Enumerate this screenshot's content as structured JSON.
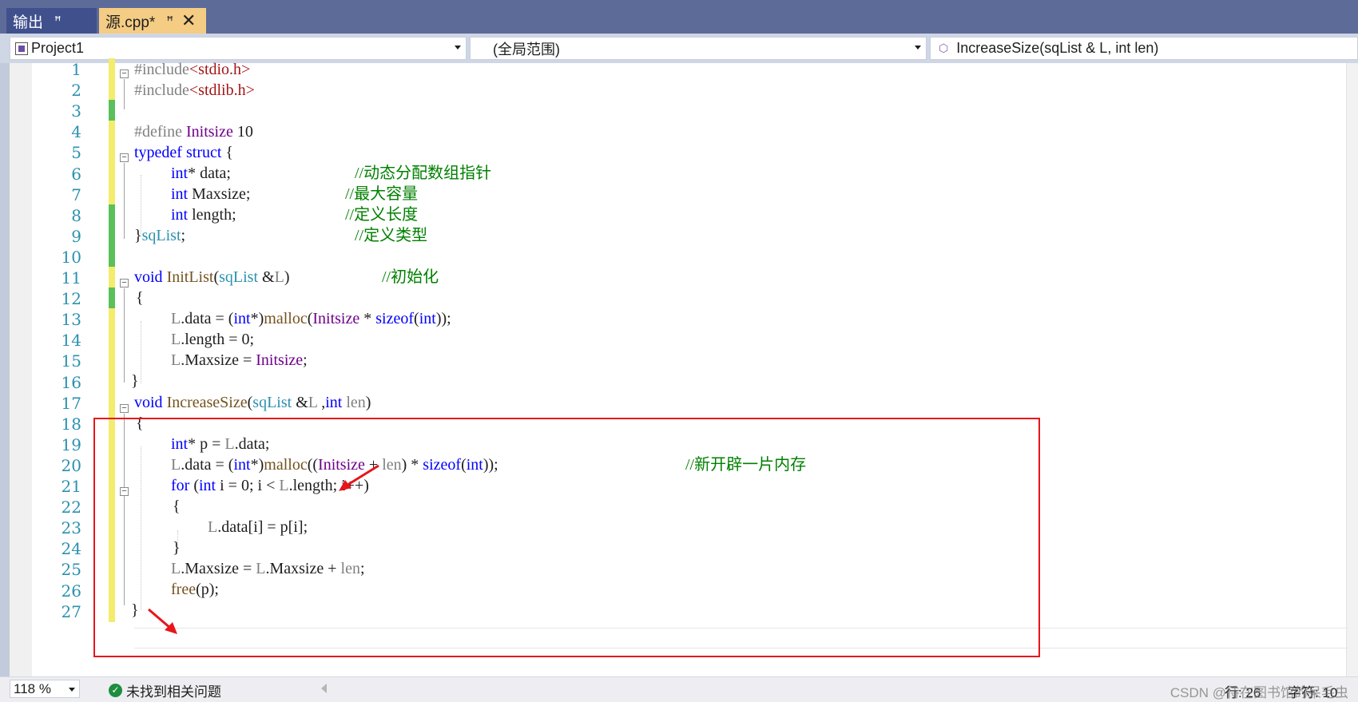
{
  "tabs": [
    {
      "label": "输出",
      "pin": "ꟸ"
    },
    {
      "label": "源.cpp*",
      "pin": "ꟸ",
      "close": "✕"
    }
  ],
  "nav": {
    "project": "Project1",
    "scope": "(全局范围)",
    "member": "IncreaseSize(sqList & L, int len)"
  },
  "line_numbers": [
    "1",
    "2",
    "3",
    "4",
    "5",
    "6",
    "7",
    "8",
    "9",
    "10",
    "11",
    "12",
    "13",
    "14",
    "15",
    "16",
    "17",
    "18",
    "19",
    "20",
    "21",
    "22",
    "23",
    "24",
    "25",
    "26",
    "27"
  ],
  "code": {
    "l1": {
      "a": "#include",
      "b": "<stdio.h>"
    },
    "l2": {
      "a": "#include",
      "b": "<stdlib.h>"
    },
    "l4": {
      "a": "#define ",
      "b": "Initsize",
      "c": " 10"
    },
    "l5": {
      "a": "typedef",
      "b": " ",
      "c": "struct",
      "d": " {"
    },
    "l6": {
      "a": "int",
      "b": "* data;",
      "c": "//动态分配数组指针"
    },
    "l7": {
      "a": "int",
      "b": " Maxsize;",
      "c": "//最大容量"
    },
    "l8": {
      "a": "int",
      "b": " length;",
      "c": "//定义长度"
    },
    "l9": {
      "a": "}",
      "b": "sqList",
      "c": ";",
      "d": "//定义类型"
    },
    "l11": {
      "a": "void",
      "b": " ",
      "c": "InitList",
      "d": "(",
      "e": "sqList",
      "f": " &",
      "g": "L",
      "h": ")",
      "i": "//初始化"
    },
    "l12": {
      "a": "{"
    },
    "l13": {
      "a": "L",
      "b": ".data = (",
      "c": "int",
      "d": "*)",
      "e": "malloc",
      "f": "(",
      "g": "Initsize",
      "h": " * ",
      "i": "sizeof",
      "j": "(",
      "k": "int",
      "l": "));"
    },
    "l14": {
      "a": "L",
      "b": ".length = 0;"
    },
    "l15": {
      "a": "L",
      "b": ".Maxsize = ",
      "c": "Initsize",
      "d": ";"
    },
    "l16": {
      "a": "}"
    },
    "l17": {
      "a": "void",
      "b": " ",
      "c": "IncreaseSize",
      "d": "(",
      "e": "sqList",
      "f": " &",
      "g": "L",
      "h": " ,",
      "i": "int",
      "j": " ",
      "k": "len",
      "l": ")"
    },
    "l18": {
      "a": "{"
    },
    "l19": {
      "a": "int",
      "b": "* p = ",
      "c": "L",
      "d": ".data;"
    },
    "l20": {
      "a": "L",
      "b": ".data = (",
      "c": "int",
      "d": "*)",
      "e": "malloc",
      "f": "((",
      "g": "Initsize",
      "h": " + ",
      "i": "len",
      "j": ") * ",
      "k": "sizeof",
      "l": "(",
      "m": "int",
      "n": "));",
      "o": "//新开辟一片内存"
    },
    "l21": {
      "a": "for",
      "b": " (",
      "c": "int",
      "d": " i = 0; i < ",
      "e": "L",
      "f": ".length; i++)"
    },
    "l22": {
      "a": "{"
    },
    "l23": {
      "a": "L",
      "b": ".data[i] = p[i];"
    },
    "l24": {
      "a": "}"
    },
    "l25": {
      "a": "L",
      "b": ".Maxsize = ",
      "c": "L",
      "d": ".Maxsize + ",
      "e": "len",
      "f": ";"
    },
    "l26": {
      "a": "free",
      "b": "(p);"
    },
    "l27": {
      "a": "}"
    }
  },
  "status": {
    "zoom": "118 %",
    "issues": "未找到相关问题",
    "row": "行: 26",
    "col": "字符: 10",
    "watermark": "CSDN @待在图书馆的呆毛虫"
  },
  "colors": {
    "keyword": "#0000ff",
    "type": "#2b91af",
    "comment": "#008000",
    "macro": "#6f008a",
    "string": "#a31515",
    "annotation": "#e8151b",
    "tab_active": "#f5cc84"
  }
}
